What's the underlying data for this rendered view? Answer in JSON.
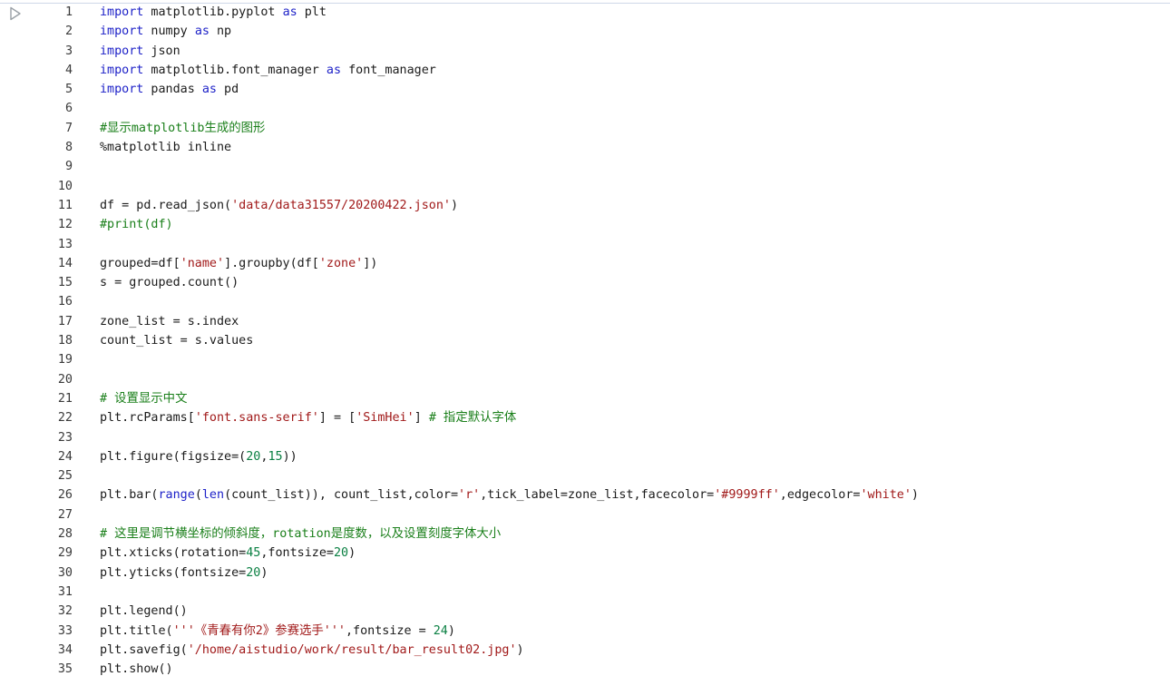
{
  "run_button": {
    "icon": "play-icon"
  },
  "lines": [
    {
      "n": "1",
      "toks": [
        [
          "kw",
          "import"
        ],
        [
          "t",
          " matplotlib.pyplot "
        ],
        [
          "kw",
          "as"
        ],
        [
          "t",
          " plt"
        ]
      ]
    },
    {
      "n": "2",
      "toks": [
        [
          "kw",
          "import"
        ],
        [
          "t",
          " numpy "
        ],
        [
          "kw",
          "as"
        ],
        [
          "t",
          " np"
        ]
      ]
    },
    {
      "n": "3",
      "toks": [
        [
          "kw",
          "import"
        ],
        [
          "t",
          " json"
        ]
      ]
    },
    {
      "n": "4",
      "toks": [
        [
          "kw",
          "import"
        ],
        [
          "t",
          " matplotlib.font_manager "
        ],
        [
          "kw",
          "as"
        ],
        [
          "t",
          " font_manager"
        ]
      ]
    },
    {
      "n": "5",
      "toks": [
        [
          "kw",
          "import"
        ],
        [
          "t",
          " pandas "
        ],
        [
          "kw",
          "as"
        ],
        [
          "t",
          " pd"
        ]
      ]
    },
    {
      "n": "6",
      "toks": []
    },
    {
      "n": "7",
      "toks": [
        [
          "cm",
          "#显示matplotlib生成的图形"
        ]
      ]
    },
    {
      "n": "8",
      "toks": [
        [
          "t",
          "%matplotlib inline"
        ]
      ]
    },
    {
      "n": "9",
      "toks": []
    },
    {
      "n": "10",
      "toks": []
    },
    {
      "n": "11",
      "toks": [
        [
          "t",
          "df = pd.read_json("
        ],
        [
          "str",
          "'data/data31557/20200422.json'"
        ],
        [
          "t",
          ")"
        ]
      ]
    },
    {
      "n": "12",
      "toks": [
        [
          "cm",
          "#print(df)"
        ]
      ]
    },
    {
      "n": "13",
      "toks": []
    },
    {
      "n": "14",
      "toks": [
        [
          "t",
          "grouped=df["
        ],
        [
          "str",
          "'name'"
        ],
        [
          "t",
          "].groupby(df["
        ],
        [
          "str",
          "'zone'"
        ],
        [
          "t",
          "])"
        ]
      ]
    },
    {
      "n": "15",
      "toks": [
        [
          "t",
          "s = grouped.count()"
        ]
      ]
    },
    {
      "n": "16",
      "toks": []
    },
    {
      "n": "17",
      "toks": [
        [
          "t",
          "zone_list = s.index"
        ]
      ]
    },
    {
      "n": "18",
      "toks": [
        [
          "t",
          "count_list = s.values"
        ]
      ]
    },
    {
      "n": "19",
      "toks": []
    },
    {
      "n": "20",
      "toks": []
    },
    {
      "n": "21",
      "toks": [
        [
          "cm",
          "# 设置显示中文"
        ]
      ]
    },
    {
      "n": "22",
      "toks": [
        [
          "t",
          "plt.rcParams["
        ],
        [
          "str",
          "'font.sans-serif'"
        ],
        [
          "t",
          "] = ["
        ],
        [
          "str",
          "'SimHei'"
        ],
        [
          "t",
          "] "
        ],
        [
          "cm",
          "# 指定默认字体"
        ]
      ]
    },
    {
      "n": "23",
      "toks": []
    },
    {
      "n": "24",
      "toks": [
        [
          "t",
          "plt.figure(figsize=("
        ],
        [
          "num",
          "20"
        ],
        [
          "t",
          ","
        ],
        [
          "num",
          "15"
        ],
        [
          "t",
          "))"
        ]
      ]
    },
    {
      "n": "25",
      "toks": []
    },
    {
      "n": "26",
      "toks": [
        [
          "t",
          "plt.bar("
        ],
        [
          "kw",
          "range"
        ],
        [
          "t",
          "("
        ],
        [
          "kw",
          "len"
        ],
        [
          "t",
          "(count_list)), count_list,color="
        ],
        [
          "str",
          "'r'"
        ],
        [
          "t",
          ",tick_label=zone_list,facecolor="
        ],
        [
          "str",
          "'#9999ff'"
        ],
        [
          "t",
          ",edgecolor="
        ],
        [
          "str",
          "'white'"
        ],
        [
          "t",
          ")"
        ]
      ]
    },
    {
      "n": "27",
      "toks": []
    },
    {
      "n": "28",
      "toks": [
        [
          "cm",
          "# 这里是调节横坐标的倾斜度，rotation是度数，以及设置刻度字体大小"
        ]
      ]
    },
    {
      "n": "29",
      "toks": [
        [
          "t",
          "plt.xticks(rotation="
        ],
        [
          "num",
          "45"
        ],
        [
          "t",
          ",fontsize="
        ],
        [
          "num",
          "20"
        ],
        [
          "t",
          ")"
        ]
      ]
    },
    {
      "n": "30",
      "toks": [
        [
          "t",
          "plt.yticks(fontsize="
        ],
        [
          "num",
          "20"
        ],
        [
          "t",
          ")"
        ]
      ]
    },
    {
      "n": "31",
      "toks": []
    },
    {
      "n": "32",
      "toks": [
        [
          "t",
          "plt.legend()"
        ]
      ]
    },
    {
      "n": "33",
      "toks": [
        [
          "t",
          "plt.title("
        ],
        [
          "str",
          "'''《青春有你2》参赛选手'''"
        ],
        [
          "t",
          ",fontsize = "
        ],
        [
          "num",
          "24"
        ],
        [
          "t",
          ")"
        ]
      ]
    },
    {
      "n": "34",
      "toks": [
        [
          "t",
          "plt.savefig("
        ],
        [
          "str",
          "'/home/aistudio/work/result/bar_result02.jpg'"
        ],
        [
          "t",
          ")"
        ]
      ]
    },
    {
      "n": "35",
      "toks": [
        [
          "t",
          "plt.show()"
        ]
      ]
    }
  ]
}
